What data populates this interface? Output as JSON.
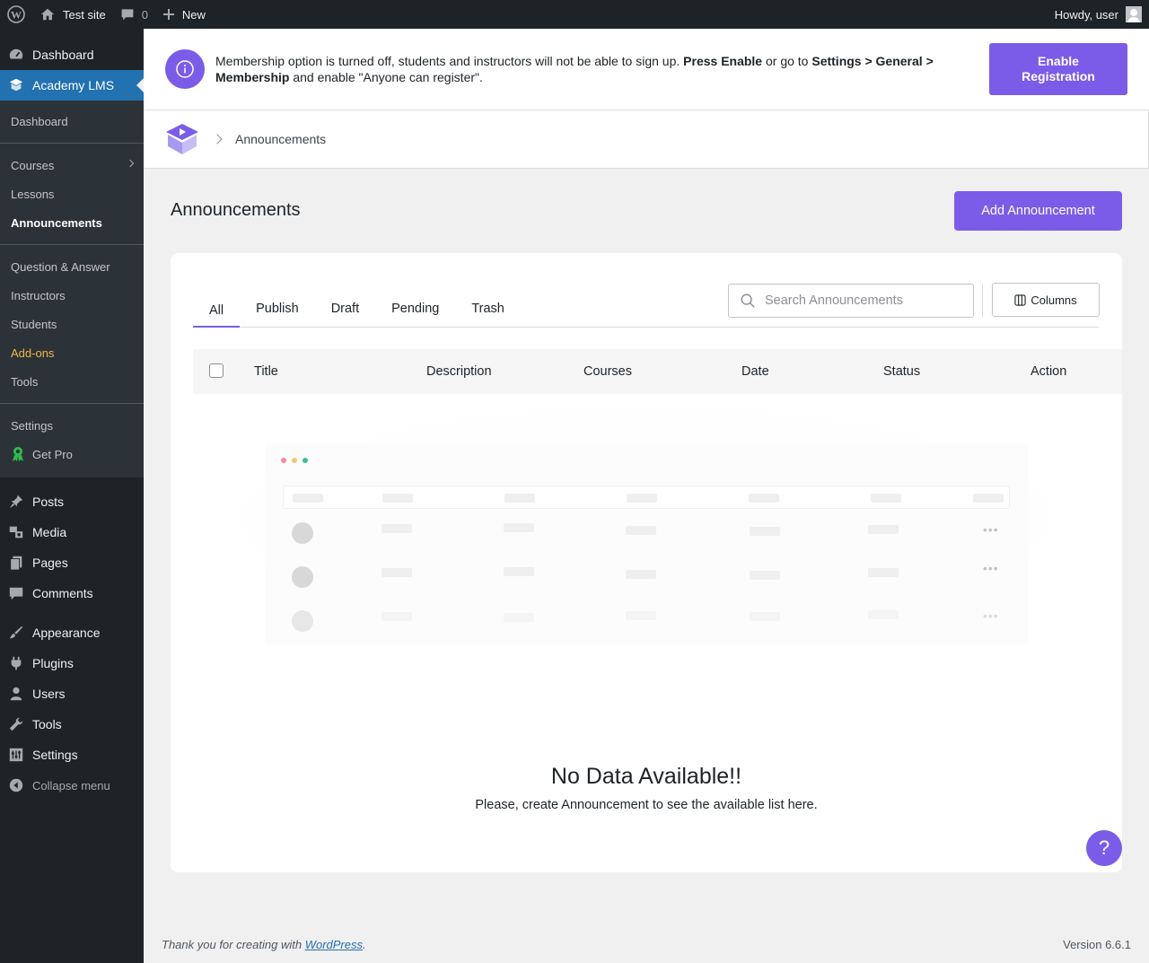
{
  "adminbar": {
    "site_name": "Test site",
    "comments_count": "0",
    "new_label": "New",
    "howdy": "Howdy, user"
  },
  "sidebar": {
    "dashboard": "Dashboard",
    "academy": "Academy LMS",
    "sub": [
      "Dashboard",
      "Courses",
      "Lessons",
      "Announcements",
      "Question & Answer",
      "Instructors",
      "Students",
      "Add-ons",
      "Tools",
      "Settings",
      "Get Pro"
    ],
    "items": [
      "Posts",
      "Media",
      "Pages",
      "Comments",
      "Appearance",
      "Plugins",
      "Users",
      "Tools",
      "Settings"
    ],
    "collapse": "Collapse menu"
  },
  "notice": {
    "text_1": "Membership option is turned off, students and instructors will not be able to sign up.",
    "text_2": "Press Enable",
    "text_3": "or go to",
    "text_4": "Settings > General > Membership",
    "text_5": "and enable \"Anyone can register\".",
    "button": "Enable Registration"
  },
  "breadcrumb": {
    "current": "Announcements"
  },
  "page": {
    "title": "Announcements",
    "add_button": "Add Announcement"
  },
  "tabs": [
    "All",
    "Publish",
    "Draft",
    "Pending",
    "Trash"
  ],
  "search": {
    "placeholder": "Search Announcements"
  },
  "columns_button": "Columns",
  "table": {
    "headers": [
      "Title",
      "Description",
      "Courses",
      "Date",
      "Status",
      "Action"
    ]
  },
  "empty": {
    "title": "No Data Available!!",
    "subtitle": "Please, create Announcement to see the available list here."
  },
  "help_label": "?",
  "footer": {
    "thanks": "Thank you for creating with",
    "link": "WordPress",
    "period": ".",
    "version": "Version 6.6.1"
  },
  "colors": {
    "accent": "#7b5ce8",
    "wp_blue": "#2271b1",
    "sidebar": "#1d2327"
  }
}
